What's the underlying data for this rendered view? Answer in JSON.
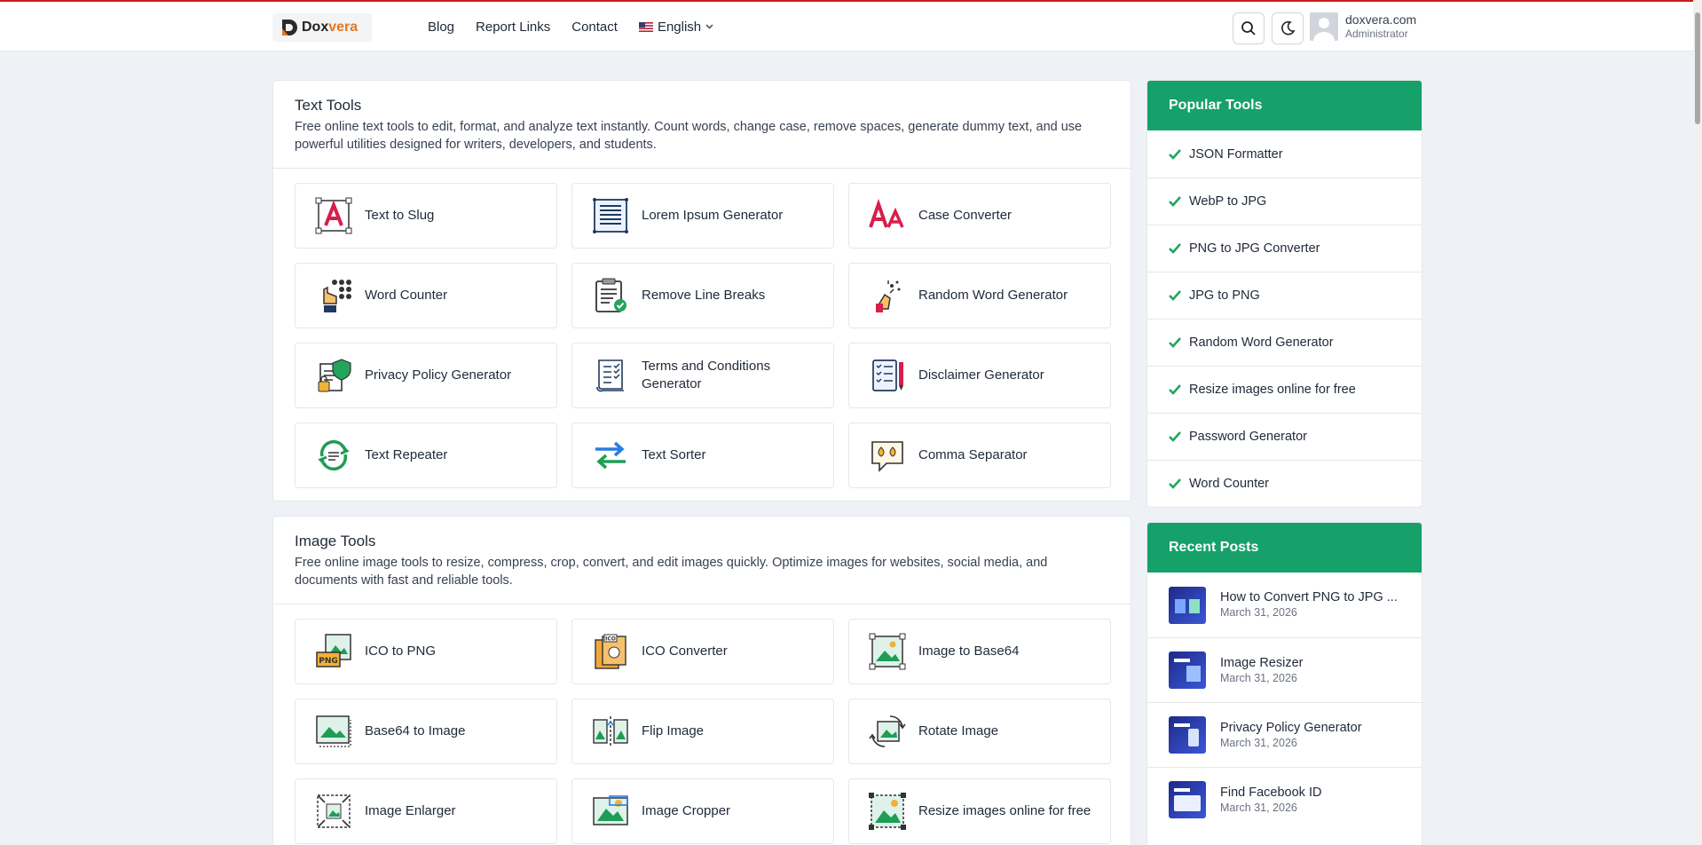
{
  "header": {
    "logo_text_1": "Dox",
    "logo_text_2": "vera",
    "nav": [
      "Blog",
      "Report Links",
      "Contact"
    ],
    "language": "English",
    "user_name": "doxvera.com",
    "user_role": "Administrator"
  },
  "text_tools": {
    "title": "Text Tools",
    "description": "Free online text tools to edit, format, and analyze text instantly. Count words, change case, remove spaces, generate dummy text, and use powerful utilities designed for writers, developers, and students.",
    "items": [
      {
        "label": "Text to Slug",
        "icon": "text-slug-icon"
      },
      {
        "label": "Lorem Ipsum Generator",
        "icon": "lorem-ipsum-icon"
      },
      {
        "label": "Case Converter",
        "icon": "case-converter-icon"
      },
      {
        "label": "Word Counter",
        "icon": "word-counter-icon"
      },
      {
        "label": "Remove Line Breaks",
        "icon": "clipboard-check-icon"
      },
      {
        "label": "Random Word Generator",
        "icon": "random-word-icon"
      },
      {
        "label": "Privacy Policy Generator",
        "icon": "privacy-policy-icon"
      },
      {
        "label": "Terms and Conditions Generator",
        "icon": "terms-icon"
      },
      {
        "label": "Disclaimer Generator",
        "icon": "disclaimer-icon"
      },
      {
        "label": "Text Repeater",
        "icon": "repeat-icon"
      },
      {
        "label": "Text Sorter",
        "icon": "sort-arrows-icon"
      },
      {
        "label": "Comma Separator",
        "icon": "comma-icon"
      }
    ]
  },
  "image_tools": {
    "title": "Image Tools",
    "description": "Free online image tools to resize, compress, crop, convert, and edit images quickly. Optimize images for websites, social media, and documents with fast and reliable tools.",
    "items": [
      {
        "label": "ICO to PNG",
        "icon": "ico-png-icon"
      },
      {
        "label": "ICO Converter",
        "icon": "ico-converter-icon"
      },
      {
        "label": "Image to Base64",
        "icon": "image-base64-icon"
      },
      {
        "label": "Base64 to Image",
        "icon": "base64-image-icon"
      },
      {
        "label": "Flip Image",
        "icon": "flip-image-icon"
      },
      {
        "label": "Rotate Image",
        "icon": "rotate-image-icon"
      },
      {
        "label": "Image Enlarger",
        "icon": "image-enlarger-icon"
      },
      {
        "label": "Image Cropper",
        "icon": "image-cropper-icon"
      },
      {
        "label": "Resize images online for free",
        "icon": "image-resize-icon"
      }
    ]
  },
  "popular_tools": {
    "title": "Popular Tools",
    "items": [
      "JSON Formatter",
      "WebP to JPG",
      "PNG to JPG Converter",
      "JPG to PNG",
      "Random Word Generator",
      "Resize images online for free",
      "Password Generator",
      "Word Counter"
    ]
  },
  "recent_posts": {
    "title": "Recent Posts",
    "items": [
      {
        "title": "How to Convert PNG to JPG ...",
        "date": "March 31, 2026"
      },
      {
        "title": "Image Resizer",
        "date": "March 31, 2026"
      },
      {
        "title": "Privacy Policy Generator",
        "date": "March 31, 2026"
      },
      {
        "title": "Find Facebook ID",
        "date": "March 31, 2026"
      }
    ]
  },
  "colors": {
    "accent": "#16a06a",
    "topline": "#c81e1e",
    "brand_orange": "#e8741e"
  }
}
